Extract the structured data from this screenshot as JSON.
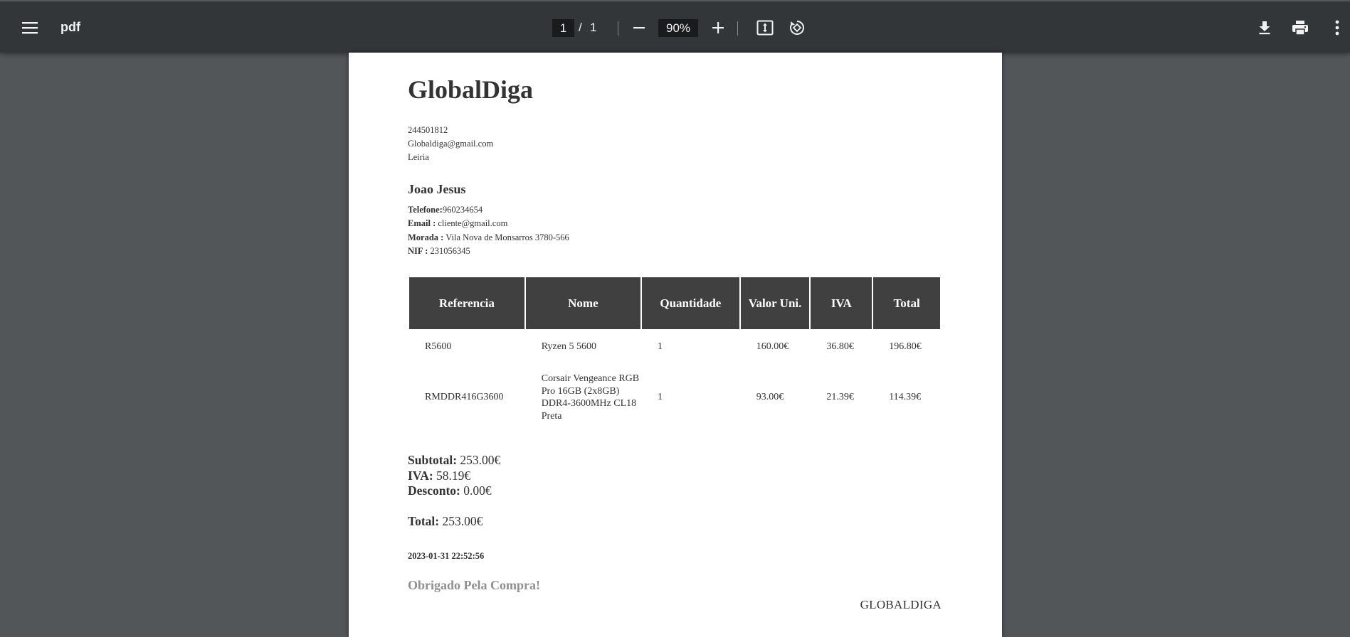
{
  "viewer": {
    "title": "pdf",
    "current_page": "1",
    "separator": "/",
    "total_pages": "1",
    "zoom": "90%",
    "icons": {
      "menu": "menu-icon",
      "zoom_out": "minus-icon",
      "zoom_in": "plus-icon",
      "fit": "fit-to-page-icon",
      "rotate": "rotate-icon",
      "download": "download-icon",
      "print": "print-icon",
      "more": "more-vert-icon"
    }
  },
  "invoice": {
    "company": "GlobalDiga",
    "company_info": [
      "244501812",
      "Globaldiga@gmail.com",
      "Leiria"
    ],
    "client": {
      "name": "Joao Jesus",
      "phone_label": "Telefone:",
      "phone": "960234654",
      "email_label": "Email :",
      "email": " cliente@gmail.com",
      "address_label": "Morada :",
      "address": " Vila Nova de Monsarros 3780-566",
      "nif_label": "NIF :",
      "nif": " 231056345"
    },
    "table": {
      "headers": [
        "Referencia",
        "Nome",
        "Quantidade",
        "Valor Uni.",
        "IVA",
        "Total"
      ],
      "rows": [
        [
          "R5600",
          "Ryzen 5 5600",
          "1",
          "160.00€",
          "36.80€",
          "196.80€"
        ],
        [
          "RMDDR416G3600",
          "Corsair Vengeance RGB Pro 16GB (2x8GB) DDR4-3600MHz CL18 Preta",
          "1",
          "93.00€",
          "21.39€",
          "114.39€"
        ]
      ]
    },
    "subtotal_label": "Subtotal:",
    "subtotal": " 253.00€",
    "iva_label": "IVA:",
    "iva": " 58.19€",
    "desconto_label": "Desconto:",
    "desconto": " 0.00€",
    "total_label": "Total:",
    "total": " 253.00€",
    "datetime": "2023-01-31 22:52:56",
    "thanks": "Obrigado Pela Compra!",
    "footer": "GLOBALDIGA"
  }
}
